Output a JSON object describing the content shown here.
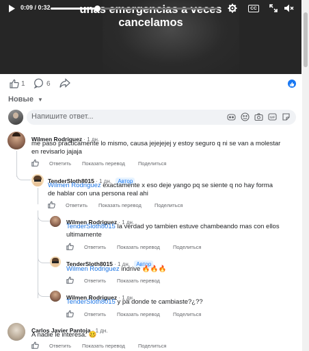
{
  "video": {
    "caption_line1": "unas emergencias a veces",
    "caption_line2": "cancelamos",
    "time": "0:09 / 0:32",
    "progress": 0.28,
    "icons": [
      "play-icon",
      "settings-icon",
      "cc-icon",
      "pip-icon",
      "fullscreen-icon",
      "volume-muted-icon"
    ],
    "cc_label": "CC"
  },
  "stats": {
    "likes": "1",
    "comments": "6"
  },
  "sort": {
    "label": "Новые"
  },
  "composer": {
    "placeholder": "Напишите ответ..."
  },
  "colors": {
    "mention": "#1b74e4",
    "author_badge_bg": "#e7f3ff",
    "author_badge_text": "#1877f2",
    "share_bubble": "#1877f2"
  },
  "comments": [
    {
      "author": "Wilmen Rodriguez",
      "time": "1 дн.",
      "line1": "me paso practicamente lo mismo, causa jejejejej y estoy seguro q ni se van a molestar",
      "line2": "en revisarlo jajaja",
      "reply": "Ответить",
      "translate": "Показать перевод",
      "share": "Поделиться"
    },
    {
      "author": "TenderSloth8015",
      "time": "1 дн.",
      "badge": "Автор",
      "mention": "Wilmen Rodriguez",
      "line1_rest": " exactamente x eso deje yango pq se siente q no hay forma",
      "line2": "de hablar con una persona real ahi",
      "reply": "Ответить",
      "translate": "Показать перевод",
      "share": "Поделиться"
    },
    {
      "author": "Wilmen Rodriguez",
      "time": "1 дн.",
      "mention": "TenderSloth8015",
      "line1_rest": " la verdad yo tambien estuve chambeando mas con ellos",
      "line2": "ultimamente",
      "reply": "Ответить",
      "translate": "Показать перевод",
      "share": "Поделиться"
    },
    {
      "author": "TenderSloth8015",
      "time": "1 дн.",
      "badge": "Автор",
      "mention": "Wilmen Rodriguez",
      "line1_rest": " indrive 🔥🔥🔥",
      "reply": "Ответить",
      "translate": "Показать перевод"
    },
    {
      "author": "Wilmen Rodriguez",
      "time": "1 дн.",
      "mention": "TenderSloth8015",
      "line1_rest": " y pa donde te cambiaste?¿??",
      "reply": "Ответить",
      "translate": "Показать перевод",
      "share": "Поделиться"
    },
    {
      "author": "Carlos Javier Pantoja",
      "time": "1 дн.",
      "line1": "A nadie le interesa. 🥴",
      "reply": "Ответить",
      "translate": "Показать перевод",
      "share": "Поделиться"
    }
  ]
}
